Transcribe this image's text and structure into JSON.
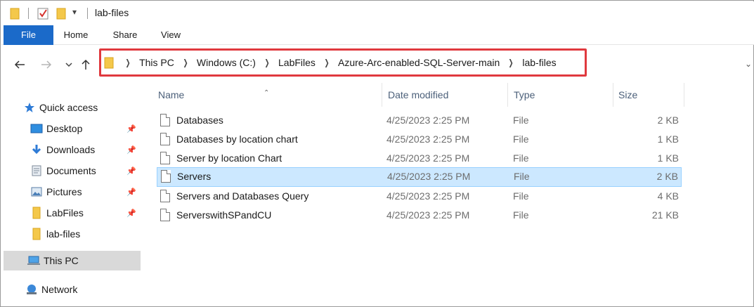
{
  "window": {
    "title": "lab-files"
  },
  "ribbon": {
    "tabs": [
      "File",
      "Home",
      "Share",
      "View"
    ]
  },
  "address": {
    "crumbs": [
      "This PC",
      "Windows (C:)",
      "LabFiles",
      "Azure-Arc-enabled-SQL-Server-main",
      "lab-files"
    ]
  },
  "nav": {
    "quick_access": "Quick access",
    "items": [
      "Desktop",
      "Downloads",
      "Documents",
      "Pictures",
      "LabFiles",
      "lab-files"
    ],
    "this_pc": "This PC",
    "network": "Network"
  },
  "columns": {
    "name": "Name",
    "date": "Date modified",
    "type": "Type",
    "size": "Size"
  },
  "files": [
    {
      "name": "Databases",
      "date": "4/25/2023 2:25 PM",
      "type": "File",
      "size": "2 KB"
    },
    {
      "name": "Databases by location chart",
      "date": "4/25/2023 2:25 PM",
      "type": "File",
      "size": "1 KB"
    },
    {
      "name": "Server by location Chart",
      "date": "4/25/2023 2:25 PM",
      "type": "File",
      "size": "1 KB"
    },
    {
      "name": "Servers",
      "date": "4/25/2023 2:25 PM",
      "type": "File",
      "size": "2 KB"
    },
    {
      "name": "Servers and Databases Query",
      "date": "4/25/2023 2:25 PM",
      "type": "File",
      "size": "4 KB"
    },
    {
      "name": "ServerswithSPandCU",
      "date": "4/25/2023 2:25 PM",
      "type": "File",
      "size": "21 KB"
    }
  ],
  "colors": {
    "accent": "#1b6ac9",
    "highlight_border": "#e0393e",
    "selection": "#cce8ff"
  }
}
